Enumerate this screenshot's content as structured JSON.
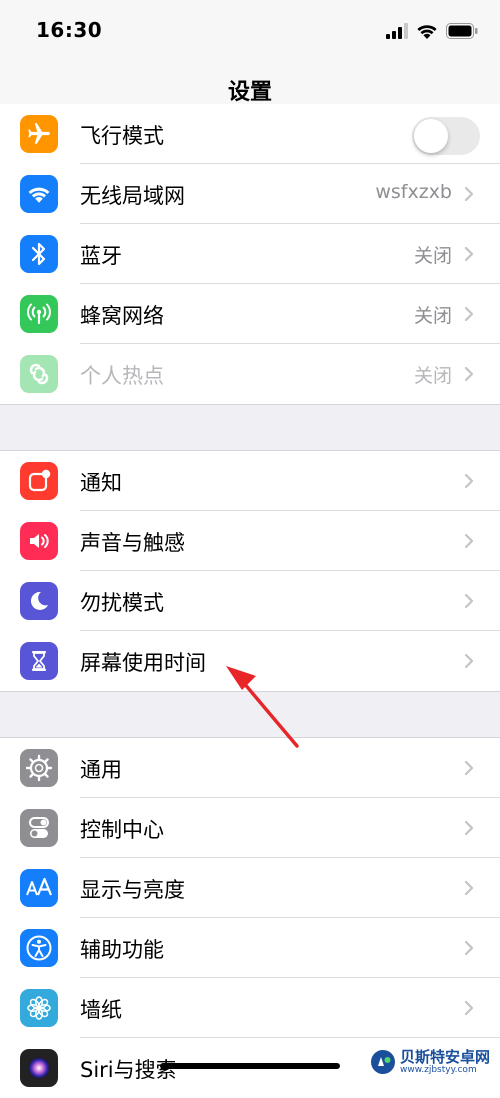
{
  "status_bar": {
    "time": "16:30"
  },
  "nav": {
    "title": "设置"
  },
  "group1": [
    {
      "label": "飞行模式",
      "value": "",
      "icon": "airplane-icon",
      "color": "#ff9500",
      "type": "toggle",
      "toggle_on": false
    },
    {
      "label": "无线局域网",
      "value": "wsfxzxb",
      "icon": "wifi-icon",
      "color": "#147efb",
      "type": "link"
    },
    {
      "label": "蓝牙",
      "value": "关闭",
      "icon": "bluetooth-icon",
      "color": "#147efb",
      "type": "link"
    },
    {
      "label": "蜂窝网络",
      "value": "关闭",
      "icon": "antenna-icon",
      "color": "#34c759",
      "type": "link"
    },
    {
      "label": "个人热点",
      "value": "关闭",
      "icon": "hotspot-icon",
      "color": "#34c759",
      "type": "link",
      "disabled": true
    }
  ],
  "group2": [
    {
      "label": "通知",
      "icon": "notification-icon",
      "color": "#ff3b30"
    },
    {
      "label": "声音与触感",
      "icon": "speaker-icon",
      "color": "#ff2d55"
    },
    {
      "label": "勿扰模式",
      "icon": "moon-icon",
      "color": "#5856d6"
    },
    {
      "label": "屏幕使用时间",
      "icon": "hourglass-icon",
      "color": "#5856d6"
    }
  ],
  "group3": [
    {
      "label": "通用",
      "icon": "gear-icon",
      "color": "#8e8e93"
    },
    {
      "label": "控制中心",
      "icon": "toggles-icon",
      "color": "#8e8e93"
    },
    {
      "label": "显示与亮度",
      "icon": "text-size-icon",
      "color": "#147efb"
    },
    {
      "label": "辅助功能",
      "icon": "accessibility-icon",
      "color": "#147efb"
    },
    {
      "label": "墙纸",
      "icon": "flower-icon",
      "color": "#34aadc"
    },
    {
      "label": "Siri与搜索",
      "icon": "siri-icon",
      "color": "#222222"
    }
  ],
  "watermark": {
    "name": "贝斯特安卓网",
    "url": "www.zjbstyy.com"
  }
}
